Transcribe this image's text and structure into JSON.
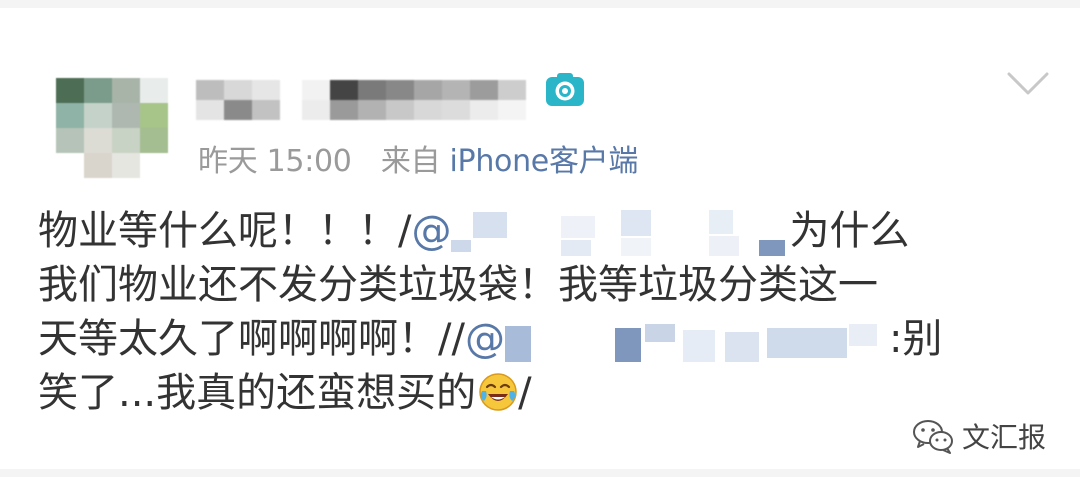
{
  "post": {
    "timestamp": "昨天 15:00",
    "source_prefix": "来自",
    "source_client": "iPhone客户端",
    "line1_text": "物业等什么呢！！！/",
    "line1_mention": "@",
    "line1_tail": "为什么",
    "line2_text": "我们物业还不发分类垃圾袋！我等垃圾分类这一",
    "line3_text": "天等太久了啊啊啊啊！//",
    "line3_mention": "@",
    "line3_tail": ":别",
    "line4_text": "笑了...我真的还蛮想买的",
    "line4_tail": "/"
  },
  "icons": {
    "camera": "camera-icon",
    "more": "chevron-down-icon",
    "emoji": "laughing-crying-emoji-icon",
    "watermark": "wechat-icon"
  },
  "watermark": {
    "label": "文汇报"
  },
  "colors": {
    "link": "#5878a8",
    "meta": "#9a9a9a",
    "camera": "#2bb5c8",
    "text": "#333333"
  }
}
